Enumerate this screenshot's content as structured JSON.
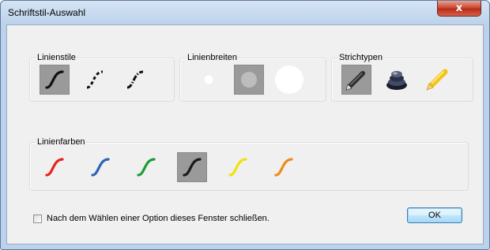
{
  "window": {
    "title": "Schriftstil-Auswahl",
    "close_glyph": "x"
  },
  "groups": {
    "line_styles": {
      "label": "Linienstile",
      "options": [
        {
          "icon": "solid-curve-icon",
          "selected": true
        },
        {
          "icon": "dashed-curve-icon",
          "selected": false
        },
        {
          "icon": "dotted-curve-icon",
          "selected": false
        }
      ]
    },
    "line_widths": {
      "label": "Linienbreiten",
      "options": [
        {
          "icon": "small-dot-icon",
          "selected": false
        },
        {
          "icon": "medium-dot-icon",
          "selected": true
        },
        {
          "icon": "large-dot-icon",
          "selected": false
        }
      ]
    },
    "stroke_types": {
      "label": "Strichtypen",
      "options": [
        {
          "icon": "pen-icon",
          "selected": true
        },
        {
          "icon": "eraser-icon",
          "selected": false
        },
        {
          "icon": "highlighter-icon",
          "selected": false
        }
      ]
    },
    "line_colors": {
      "label": "Linienfarben",
      "options": [
        {
          "icon": "red-curve-icon",
          "color": "#e8231c",
          "selected": false
        },
        {
          "icon": "blue-curve-icon",
          "color": "#2f64b4",
          "selected": false
        },
        {
          "icon": "green-curve-icon",
          "color": "#1e9c35",
          "selected": false
        },
        {
          "icon": "black-curve-icon",
          "color": "#1a1a1a",
          "selected": true
        },
        {
          "icon": "yellow-curve-icon",
          "color": "#f2e20a",
          "selected": false
        },
        {
          "icon": "orange-curve-icon",
          "color": "#f08a1a",
          "selected": false
        }
      ]
    }
  },
  "footer": {
    "close_after_select_label": "Nach dem Wählen einer Option dieses Fenster schließen.",
    "close_after_select_checked": false,
    "ok_label": "OK"
  }
}
